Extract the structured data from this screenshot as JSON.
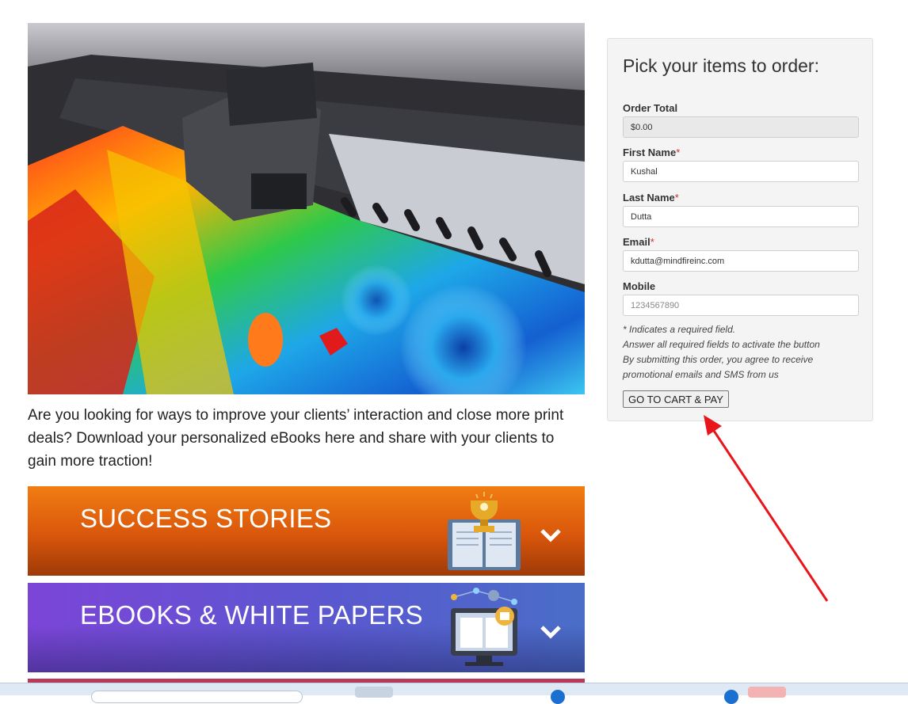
{
  "intro_text": "Are you looking for ways to improve your clients’ interaction and close more print deals? Download your personalized eBooks here and share with your clients to gain more traction!",
  "banners": [
    {
      "title": "SUCCESS STORIES",
      "icon": "trophy-book-icon"
    },
    {
      "title": "EBOOKS & WHITE PAPERS",
      "icon": "monitor-book-icon"
    }
  ],
  "order_form": {
    "heading": "Pick your items to order:",
    "required_mark": "*",
    "order_total": {
      "label": "Order Total",
      "value": "$0.00"
    },
    "first_name": {
      "label": "First Name",
      "value": "Kushal"
    },
    "last_name": {
      "label": "Last Name",
      "value": "Dutta"
    },
    "email": {
      "label": "Email",
      "value": "kdutta@mindfireinc.com"
    },
    "mobile": {
      "label": "Mobile",
      "value": "",
      "placeholder": "1234567890"
    },
    "notes": [
      "* Indicates a required field.",
      "Answer all required fields to activate the button",
      "By submitting this order, you agree to receive",
      "promotional emails and SMS from us"
    ],
    "submit_label": "GO TO CART & PAY"
  },
  "annotation": {
    "arrow_color": "#e8151b"
  },
  "colors": {
    "required": "#c9302c",
    "banner_orange": "#e8650f",
    "banner_purple": "#6a4fd6"
  }
}
